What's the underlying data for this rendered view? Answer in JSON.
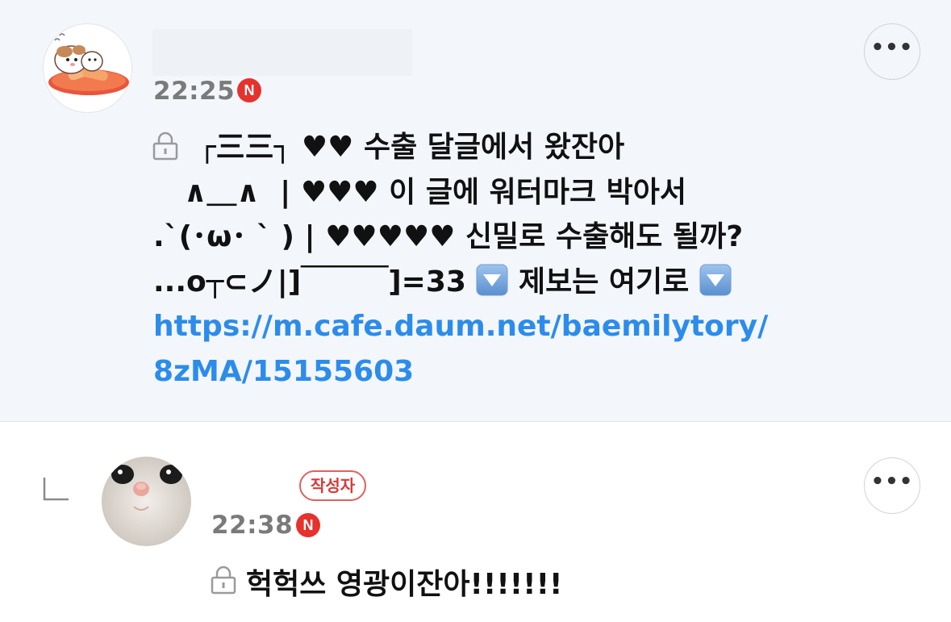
{
  "comments": [
    {
      "time": "22:25",
      "badge": "N",
      "more_label": "•••",
      "body": {
        "line1": "┌三三┐ ♥♥ 수출 달글에서 왔잔아",
        "line2": "   ∧＿∧  | ♥♥♥ 이 글에 워터마크 박아서",
        "line3": ".`(･ω･ ` ) | ♥♥♥♥♥ 신밀로 수출해도 될까?",
        "line4a": "...o┬⊂ノ|]￣￣￣]=33 ",
        "line4b": " 제보는 여기로 ",
        "link_line1": "https://m.cafe.daum.net/baemilytory/",
        "link_line2": "8zMA/15155603"
      }
    },
    {
      "time": "22:38",
      "badge": "N",
      "author_badge": "작성자",
      "more_label": "•••",
      "body": "헉헉쓰 영광이잔아!!!!!!!"
    }
  ],
  "icons": {
    "lock": "lock-icon",
    "more": "more-icon",
    "reply": "reply-arrow-icon",
    "down_box": "down-arrow-box-icon"
  },
  "colors": {
    "link": "#2c8ceb",
    "badge_red": "#e5322d",
    "author_badge": "#d63b3b",
    "top_comment_bg": "#f3f6fb"
  }
}
